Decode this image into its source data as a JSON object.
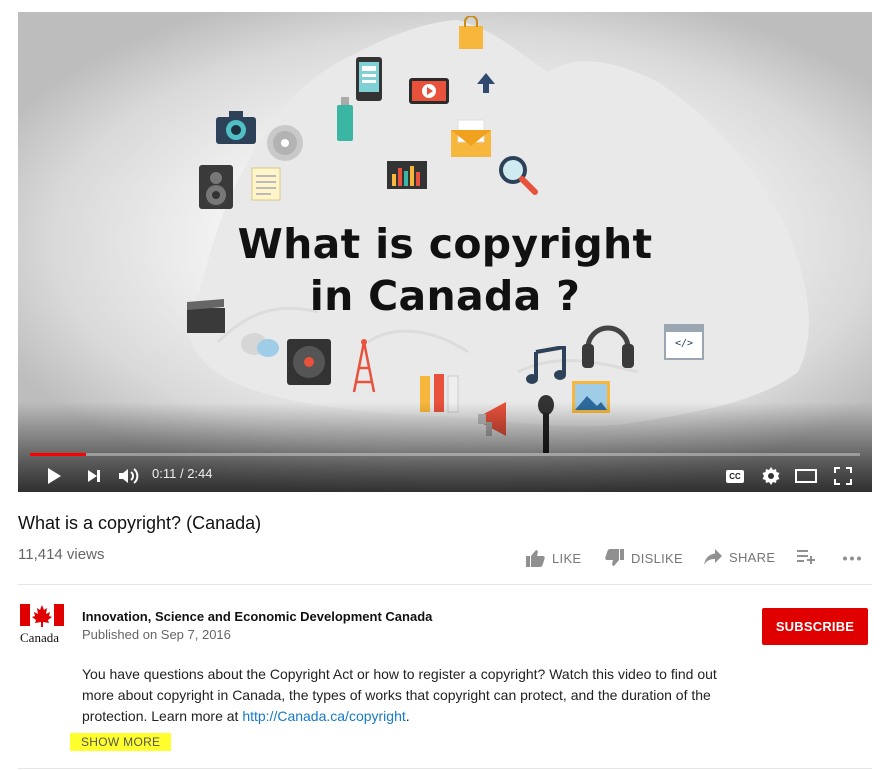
{
  "video": {
    "frame_title_line1": "What is copyright",
    "frame_title_line2": "in Canada ?",
    "current_time": "0:11",
    "duration": "2:44",
    "progress_fraction": 0.067,
    "cc_label": "CC",
    "code_tag": "</>"
  },
  "info": {
    "title": "What is a copyright? (Canada)",
    "views": "11,414 views",
    "actions": {
      "like": "LIKE",
      "dislike": "DISLIKE",
      "share": "SHARE"
    }
  },
  "channel": {
    "name": "Innovation, Science and Economic Development Canada",
    "published": "Published on Sep 7, 2016",
    "logo_text": "Canada",
    "subscribe_label": "SUBSCRIBE"
  },
  "description": {
    "text": "You have questions about the Copyright Act or how to register a copyright? Watch this video to find out more about copyright in Canada, the types of works that copyright can protect, and the duration of the protection. Learn more at ",
    "link": "http://Canada.ca/copyright",
    "tail": ".",
    "show_more": "SHOW MORE"
  },
  "colors": {
    "accent_red": "#e00000",
    "progress_red": "#ff0000",
    "link_blue": "#167ac6",
    "highlight_yellow": "#ffff2e"
  }
}
